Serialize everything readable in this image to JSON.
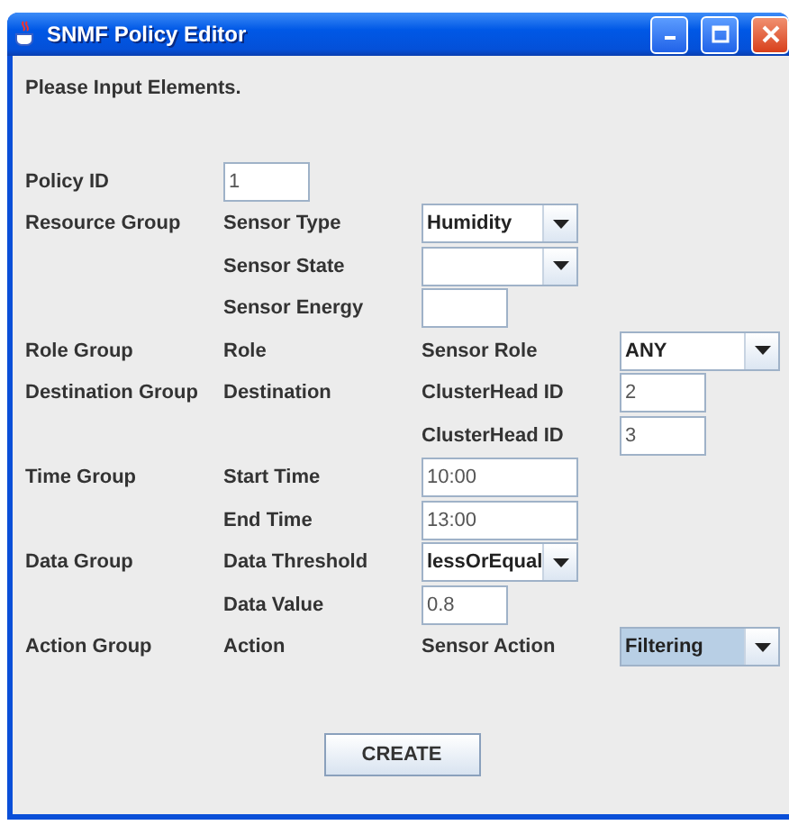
{
  "window": {
    "title": "SNMF Policy Editor"
  },
  "prompt": "Please Input Elements.",
  "rows": [
    {
      "cells": [
        {
          "kind": "label",
          "text": "Policy ID"
        },
        {
          "kind": "field",
          "value": "1"
        }
      ]
    },
    {
      "cells": [
        {
          "kind": "label",
          "text": "Resource Group"
        },
        {
          "kind": "label",
          "text": "Sensor Type"
        },
        {
          "kind": "combo",
          "value": "Humidity",
          "focused": false
        }
      ]
    },
    {
      "cells": [
        {
          "kind": "gap"
        },
        {
          "kind": "label",
          "text": "Sensor State"
        },
        {
          "kind": "combo",
          "focused": false
        }
      ]
    },
    {
      "cells": [
        {
          "kind": "gap"
        },
        {
          "kind": "label",
          "text": "Sensor Energy"
        },
        {
          "kind": "field"
        }
      ]
    },
    {
      "cells": [
        {
          "kind": "label",
          "text": "Role Group"
        },
        {
          "kind": "label",
          "text": "Role"
        },
        {
          "kind": "label",
          "text": "Sensor Role"
        },
        {
          "kind": "combo",
          "value": "ANY",
          "focused": false
        }
      ]
    },
    {
      "cells": [
        {
          "kind": "label",
          "text": "Destination Group"
        },
        {
          "kind": "label",
          "text": "Destination"
        },
        {
          "kind": "label",
          "text": "ClusterHead ID"
        },
        {
          "kind": "field",
          "value": "2"
        }
      ]
    },
    {
      "cells": [
        {
          "kind": "gap"
        },
        {
          "kind": "gap"
        },
        {
          "kind": "label",
          "text": "ClusterHead ID"
        },
        {
          "kind": "field",
          "value": "3"
        }
      ]
    },
    {
      "cells": [
        {
          "kind": "label",
          "text": "Time Group"
        },
        {
          "kind": "label",
          "text": "Start Time"
        },
        {
          "kind": "wide-field",
          "value": "10:00"
        }
      ]
    },
    {
      "cells": [
        {
          "kind": "gap"
        },
        {
          "kind": "label",
          "text": "End Time"
        },
        {
          "kind": "wide-field",
          "value": "13:00"
        }
      ]
    },
    {
      "cells": [
        {
          "kind": "label",
          "text": "Data Group"
        },
        {
          "kind": "label",
          "text": "Data Threshold"
        },
        {
          "kind": "combo",
          "value": "lessOrEqual",
          "focused": false
        }
      ]
    },
    {
      "cells": [
        {
          "kind": "gap"
        },
        {
          "kind": "label",
          "text": "Data Value"
        },
        {
          "kind": "field",
          "value": "0.8"
        }
      ]
    },
    {
      "cells": [
        {
          "kind": "label",
          "text": "Action Group"
        },
        {
          "kind": "label",
          "text": "Action"
        },
        {
          "kind": "label",
          "text": "Sensor Action"
        },
        {
          "kind": "combo",
          "value": "Filtering",
          "focused": true
        }
      ]
    }
  ],
  "buttons": [
    "CREATE"
  ]
}
